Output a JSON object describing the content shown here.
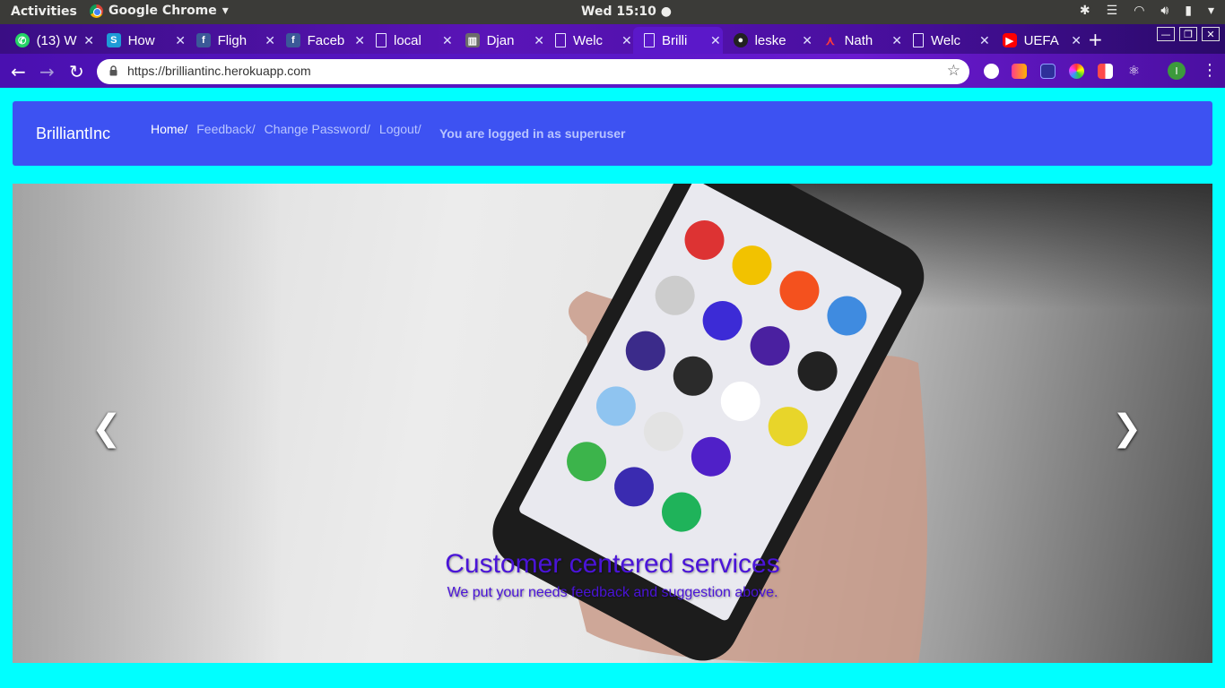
{
  "desktop": {
    "activities": "Activities",
    "app_name": "Google Chrome",
    "clock": "Wed 15:10"
  },
  "tabs": [
    {
      "title": "(13) W",
      "icon": "whatsapp-icon"
    },
    {
      "title": "How",
      "icon": "s-icon"
    },
    {
      "title": "Fligh",
      "icon": "facebook-icon"
    },
    {
      "title": "Faceb",
      "icon": "facebook-icon"
    },
    {
      "title": "local",
      "icon": "page-icon"
    },
    {
      "title": "Djan",
      "icon": "django-icon"
    },
    {
      "title": "Welc",
      "icon": "page-icon"
    },
    {
      "title": "Brilli",
      "icon": "page-icon"
    },
    {
      "title": "leske",
      "icon": "github-icon"
    },
    {
      "title": "Nath",
      "icon": "pdf-icon"
    },
    {
      "title": "Welc",
      "icon": "page-icon"
    },
    {
      "title": "UEFA",
      "icon": "youtube-icon"
    }
  ],
  "browser": {
    "url": "https://brilliantinc.herokuapp.com",
    "profile_initial": "I"
  },
  "site": {
    "brand": "BrilliantInc",
    "nav": [
      "Home/",
      "Feedback/",
      "Change Password/",
      "Logout/"
    ],
    "login_status": "You are logged in as superuser",
    "caption_title": "Customer centered services",
    "caption_text": "We put your needs feedback and suggestion above."
  },
  "colors": {
    "page_background": "#00ffff",
    "navbar": "#3d52f2",
    "caption": "#4a14d8"
  }
}
